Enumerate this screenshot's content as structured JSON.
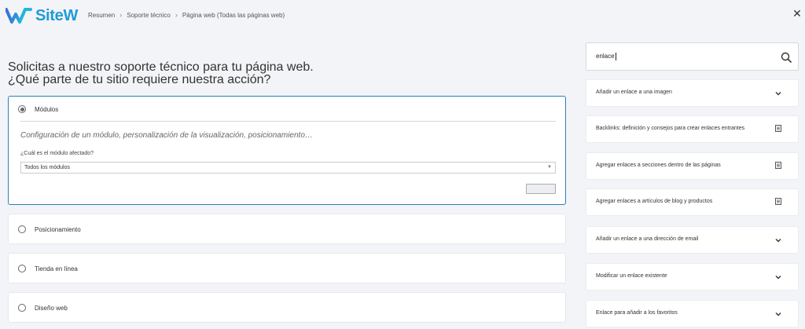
{
  "header": {
    "brand": "SiteW",
    "breadcrumb": [
      "Resumen",
      "Soporte técnico",
      "Página web (Todas las páginas web)"
    ],
    "close": "✕"
  },
  "title": {
    "line1": "Solicitas a nuestro soporte técnico para tu página web.",
    "line2": "¿Qué parte de tu sitio requiere nuestra acción?"
  },
  "options": [
    {
      "label": "Módulos",
      "selected": true,
      "description": "Configuración de un módulo, personalización de la visualización, posicionamiento…",
      "question": "¿Cuál es el módulo afectado?",
      "select_value": "Todos los módulos"
    },
    {
      "label": "Posicionamiento",
      "selected": false
    },
    {
      "label": "Tienda en línea",
      "selected": false
    },
    {
      "label": "Diseño web",
      "selected": false
    }
  ],
  "search": {
    "value": "enlace"
  },
  "help_items": [
    {
      "label": "Añadir un enlace a una imagen",
      "icon": "chevron-down-icon"
    },
    {
      "label": "Backlinks: definición y consejos para crear enlaces entrantes",
      "icon": "document-icon"
    },
    {
      "label": "Agregar enlaces a secciones dentro de las páginas",
      "icon": "document-icon"
    },
    {
      "label": "Agregar enlaces a artículos de blog y productos",
      "icon": "document-icon"
    },
    {
      "label": "Añadir un enlace a una dirección de email",
      "icon": "chevron-down-icon"
    },
    {
      "label": "Modificar un enlace existente",
      "icon": "chevron-down-icon"
    },
    {
      "label": "Enlace para añadir a los favoritos",
      "icon": "chevron-down-icon"
    }
  ],
  "colors": {
    "brand": "#1f9bd6",
    "active_border": "#2b7fb3",
    "background": "#f3f4f8"
  }
}
